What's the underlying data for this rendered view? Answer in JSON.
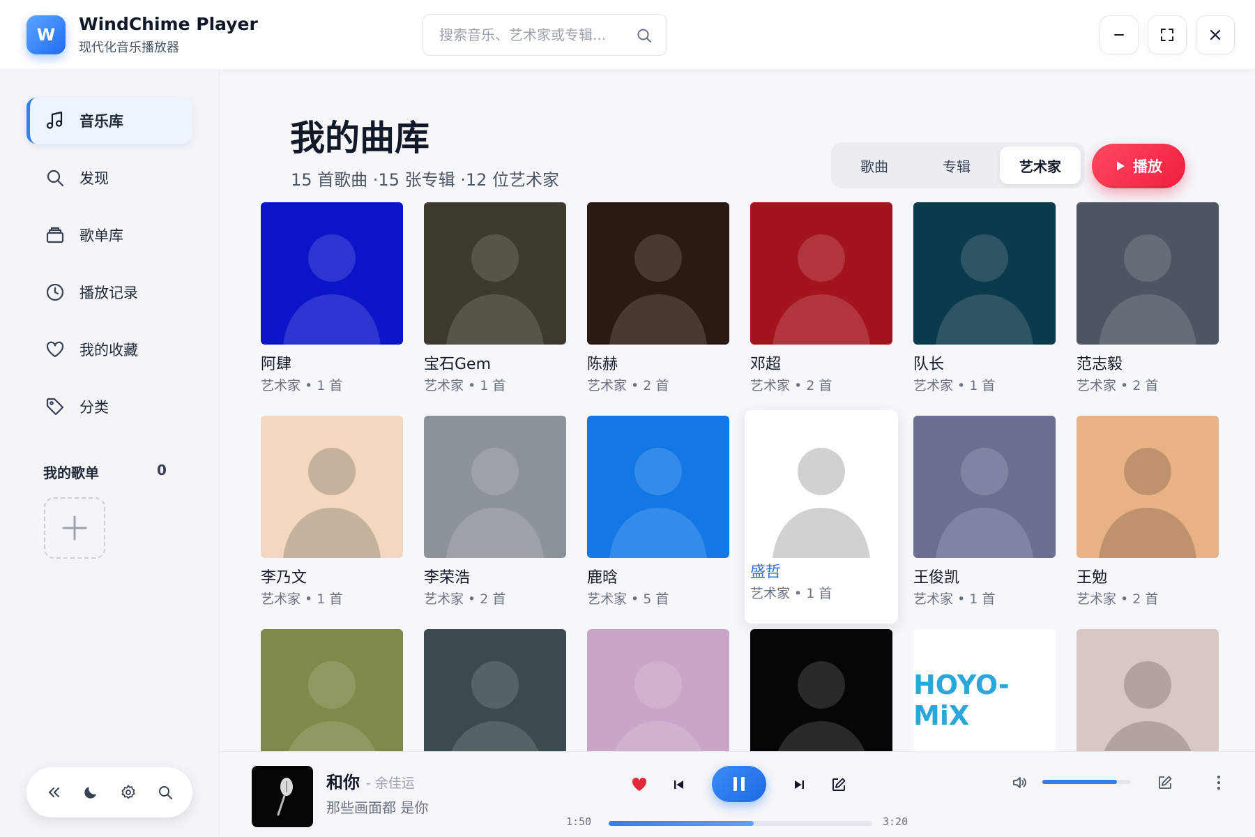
{
  "app": {
    "logo_letter": "W",
    "name": "WindChime Player",
    "subtitle": "现代化音乐播放器"
  },
  "search": {
    "placeholder": "搜索音乐、艺术家或专辑..."
  },
  "window_controls": [
    "minimize-icon",
    "fullscreen-icon",
    "close-icon"
  ],
  "sidebar": {
    "items": [
      {
        "label": "音乐库",
        "icon": "music-note-icon",
        "active": true
      },
      {
        "label": "发现",
        "icon": "search-icon",
        "active": false
      },
      {
        "label": "歌单库",
        "icon": "library-icon",
        "active": false
      },
      {
        "label": "播放记录",
        "icon": "clock-icon",
        "active": false
      },
      {
        "label": "我的收藏",
        "icon": "heart-icon",
        "active": false
      },
      {
        "label": "分类",
        "icon": "tag-icon",
        "active": false
      }
    ],
    "playlists_title": "我的歌单",
    "playlists_count": "0",
    "tools": [
      "collapse-icon",
      "moon-icon",
      "settings-icon",
      "search-icon"
    ]
  },
  "main": {
    "title": "我的曲库",
    "stats": "15 首歌曲 ·15 张专辑 ·12 位艺术家",
    "tabs": [
      {
        "label": "歌曲",
        "active": false
      },
      {
        "label": "专辑",
        "active": false
      },
      {
        "label": "艺术家",
        "active": true
      }
    ],
    "play_label": "播放",
    "artists": [
      {
        "name": "阿肆",
        "meta": "艺术家 • 1 首",
        "bg": "#0a14c8"
      },
      {
        "name": "宝石Gem",
        "meta": "艺术家 • 1 首",
        "bg": "#3b3a2c"
      },
      {
        "name": "陈赫",
        "meta": "艺术家 • 2 首",
        "bg": "#2a1a12"
      },
      {
        "name": "邓超",
        "meta": "艺术家 • 2 首",
        "bg": "#a4141c"
      },
      {
        "name": "队长",
        "meta": "艺术家 • 1 首",
        "bg": "#0b3a4a"
      },
      {
        "name": "范志毅",
        "meta": "艺术家 • 2 首",
        "bg": "#4d5560"
      },
      {
        "name": "李乃文",
        "meta": "艺术家 • 1 首",
        "bg": "#f1d8bf"
      },
      {
        "name": "李荣浩",
        "meta": "艺术家 • 2 首",
        "bg": "#8d939b"
      },
      {
        "name": "鹿晗",
        "meta": "艺术家 • 5 首",
        "bg": "#1378e6"
      },
      {
        "name": "盛哲",
        "meta": "艺术家 • 1 首",
        "bg": "#ffffff"
      },
      {
        "name": "王俊凯",
        "meta": "艺术家 • 1 首",
        "bg": "#6c6f92"
      },
      {
        "name": "王勉",
        "meta": "艺术家 • 2 首",
        "bg": "#e8b285"
      },
      {
        "name": "",
        "meta": "",
        "bg": "#7d8a4a"
      },
      {
        "name": "",
        "meta": "",
        "bg": "#3a4a4e"
      },
      {
        "name": "",
        "meta": "",
        "bg": "#c9a6c8"
      },
      {
        "name": "",
        "meta": "",
        "bg": "#060606"
      },
      {
        "name": "",
        "meta": "",
        "bg": "#ffffff",
        "logo_text": "HOYO-MiX"
      },
      {
        "name": "",
        "meta": "",
        "bg": "#d8c8c4"
      }
    ]
  },
  "player": {
    "title": "和你",
    "artist": "- 余佳运",
    "lyric": "那些画面都 是你",
    "time_current": "1:50",
    "time_total": "3:20",
    "progress": 0.55,
    "volume": 0.85,
    "liked": true
  },
  "colors": {
    "accent": "#2f80ed",
    "play_red": "#ef1d3b",
    "heart_red": "#e5293c"
  }
}
